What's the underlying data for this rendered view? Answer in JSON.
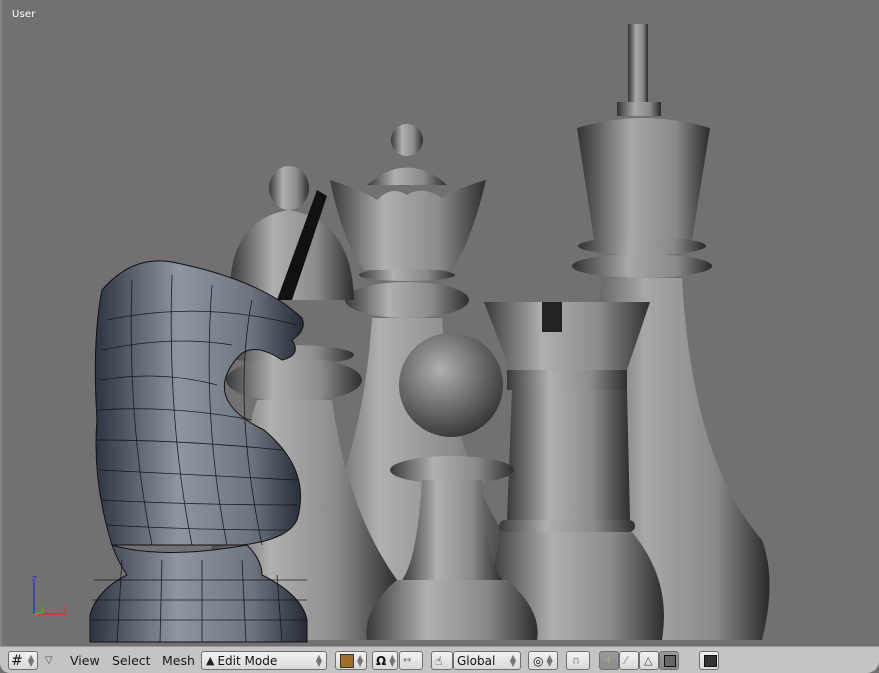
{
  "viewport": {
    "view_label": "User",
    "background_color": "#727072",
    "axis": {
      "x_label": "x",
      "y_label": "y",
      "z_label": "z",
      "x_color": "#e03030",
      "y_color": "#30c030",
      "z_color": "#3030d0"
    },
    "selected_mesh": "Knight",
    "vertex_color": "#e070e0",
    "pieces": [
      "Knight",
      "Bishop",
      "Queen",
      "Pawn",
      "Rook",
      "King"
    ]
  },
  "header": {
    "editor_type_icon": "grid-icon",
    "menus": [
      "View",
      "Select",
      "Mesh"
    ],
    "mode": {
      "icon": "edit-mode-triangle-icon",
      "label": "Edit Mode"
    },
    "draw_type_icon": "shaded-cube-icon",
    "pivot_icon": "pivot-icon",
    "transform_widget_icon": "transform-widget-icon",
    "manipulator_icon": "hand-icon",
    "orientation": "Global",
    "proportional_icon": "proportional-edit-icon",
    "snap_icon": "magnet-icon",
    "select_modes": [
      {
        "name": "vertex",
        "active": true
      },
      {
        "name": "edge",
        "active": false
      },
      {
        "name": "face",
        "active": false
      }
    ],
    "occlude_icon": "occlude-cube-icon",
    "render_icon": "render-image-icon"
  }
}
